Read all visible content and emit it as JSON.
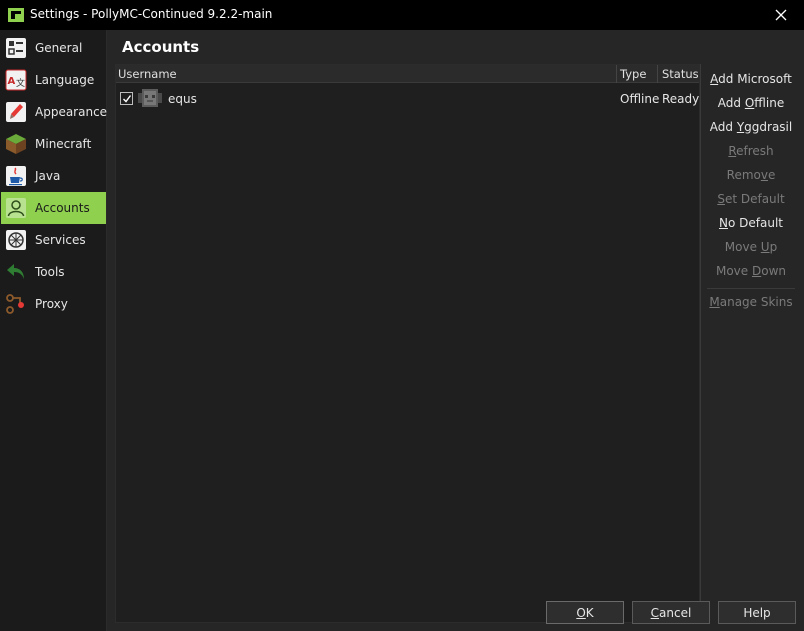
{
  "window": {
    "title": "Settings - PollyMC-Continued 9.2.2-main"
  },
  "colors": {
    "accent": "#8fd14f",
    "titlebar": "#000000",
    "background": "#262626"
  },
  "sidebar": {
    "items": [
      {
        "label": "General",
        "icon": "general-icon"
      },
      {
        "label": "Language",
        "icon": "language-icon"
      },
      {
        "label": "Appearance",
        "icon": "appearance-icon"
      },
      {
        "label": "Minecraft",
        "icon": "minecraft-icon"
      },
      {
        "label": "Java",
        "icon": "java-icon"
      },
      {
        "label": "Accounts",
        "icon": "accounts-icon",
        "selected": true
      },
      {
        "label": "Services",
        "icon": "services-icon"
      },
      {
        "label": "Tools",
        "icon": "tools-icon"
      },
      {
        "label": "Proxy",
        "icon": "proxy-icon"
      }
    ]
  },
  "page": {
    "title": "Accounts"
  },
  "table": {
    "columns": [
      "Username",
      "Type",
      "Status"
    ],
    "rows": [
      {
        "checked": true,
        "username": "equs",
        "type": "Offline",
        "status": "Ready"
      }
    ]
  },
  "actions": {
    "add_microsoft": {
      "pre": "",
      "key": "A",
      "post": "dd Microsoft"
    },
    "add_offline": {
      "pre": "Add ",
      "key": "O",
      "post": "ffline"
    },
    "add_yggdrasil": {
      "pre": "Add ",
      "key": "Y",
      "post": "ggdrasil"
    },
    "refresh": {
      "pre": "",
      "key": "R",
      "post": "efresh"
    },
    "remove": {
      "pre": "Remo",
      "key": "v",
      "post": "e"
    },
    "set_default": {
      "pre": "",
      "key": "S",
      "post": "et Default"
    },
    "no_default": {
      "pre": "",
      "key": "N",
      "post": "o Default"
    },
    "move_up": {
      "pre": "Move ",
      "key": "U",
      "post": "p"
    },
    "move_down": {
      "pre": "Move ",
      "key": "D",
      "post": "own"
    },
    "manage_skins": {
      "pre": "",
      "key": "M",
      "post": "anage Skins"
    }
  },
  "buttons": {
    "ok": {
      "pre": "",
      "key": "O",
      "post": "K"
    },
    "cancel": {
      "pre": "",
      "key": "C",
      "post": "ancel"
    },
    "help": {
      "label": "Help"
    }
  }
}
